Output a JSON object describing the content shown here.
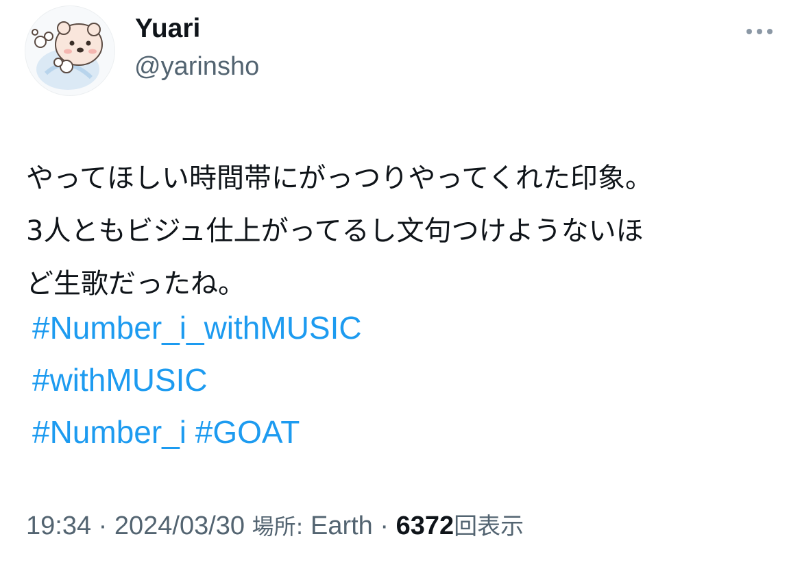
{
  "author": {
    "display_name": "Yuari",
    "handle": "@yarinsho",
    "avatar_icon": "bear-cartoon-avatar"
  },
  "menu": {
    "icon": "more-horizontal-icon"
  },
  "tweet": {
    "lines": [
      "やってほしい時間帯にがっつりやってくれた印象。",
      "3人ともビジュ仕上がってるし文句つけようないほ",
      "ど生歌だったね。"
    ],
    "hashtags": [
      [
        "#Number_i_withMUSIC"
      ],
      [
        "#withMUSIC"
      ],
      [
        "#Number_i",
        "#GOAT"
      ]
    ]
  },
  "meta": {
    "time": "19:34",
    "separator": "·",
    "date": "2024/03/30",
    "location_label": "場所:",
    "location": "Earth",
    "views_count": "6372",
    "views_label": "回表示"
  },
  "colors": {
    "link": "#1d9bf0",
    "text": "#0f1419",
    "secondary": "#536471"
  }
}
